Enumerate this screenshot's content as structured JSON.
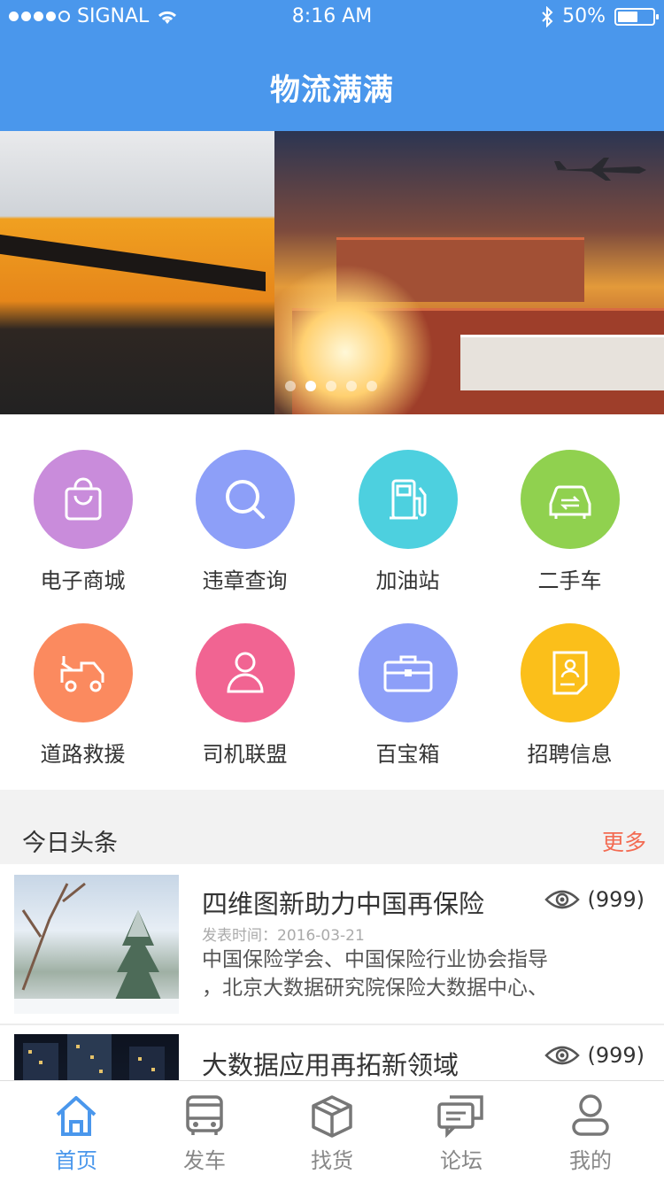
{
  "status_bar": {
    "carrier": "SIGNAL",
    "time": "8:16 AM",
    "battery": "50%"
  },
  "header": {
    "title": "物流满满"
  },
  "banner": {
    "page_count": 5,
    "active_page": 2
  },
  "services": [
    {
      "label": "电子商城",
      "icon": "shopping-bag-icon",
      "color": "#c98cdb"
    },
    {
      "label": "违章查询",
      "icon": "search-icon",
      "color": "#8d9ff8"
    },
    {
      "label": "加油站",
      "icon": "gas-pump-icon",
      "color": "#4dd0df"
    },
    {
      "label": "二手车",
      "icon": "car-swap-icon",
      "color": "#90d14f"
    },
    {
      "label": "道路救援",
      "icon": "tow-truck-icon",
      "color": "#fb8a5f"
    },
    {
      "label": "司机联盟",
      "icon": "driver-icon",
      "color": "#f16492"
    },
    {
      "label": "百宝箱",
      "icon": "toolbox-icon",
      "color": "#8d9ff8"
    },
    {
      "label": "招聘信息",
      "icon": "resume-icon",
      "color": "#fbbf1a"
    }
  ],
  "news": {
    "section_title": "今日头条",
    "more_label": "更多",
    "items": [
      {
        "title": "四维图新助力中国再保险",
        "date": "发表时间：2016-03-21",
        "desc_line1": "中国保险学会、中国保险行业协会指导",
        "desc_line2": "，北京大数据研究院保险大数据中心、",
        "views": "(999)"
      },
      {
        "title": "大数据应用再拓新领域",
        "views": "(999)"
      }
    ]
  },
  "tabs": [
    {
      "label": "首页",
      "icon": "home-icon",
      "active": true
    },
    {
      "label": "发车",
      "icon": "bus-icon",
      "active": false
    },
    {
      "label": "找货",
      "icon": "package-icon",
      "active": false
    },
    {
      "label": "论坛",
      "icon": "chat-icon",
      "active": false
    },
    {
      "label": "我的",
      "icon": "profile-icon",
      "active": false
    }
  ]
}
